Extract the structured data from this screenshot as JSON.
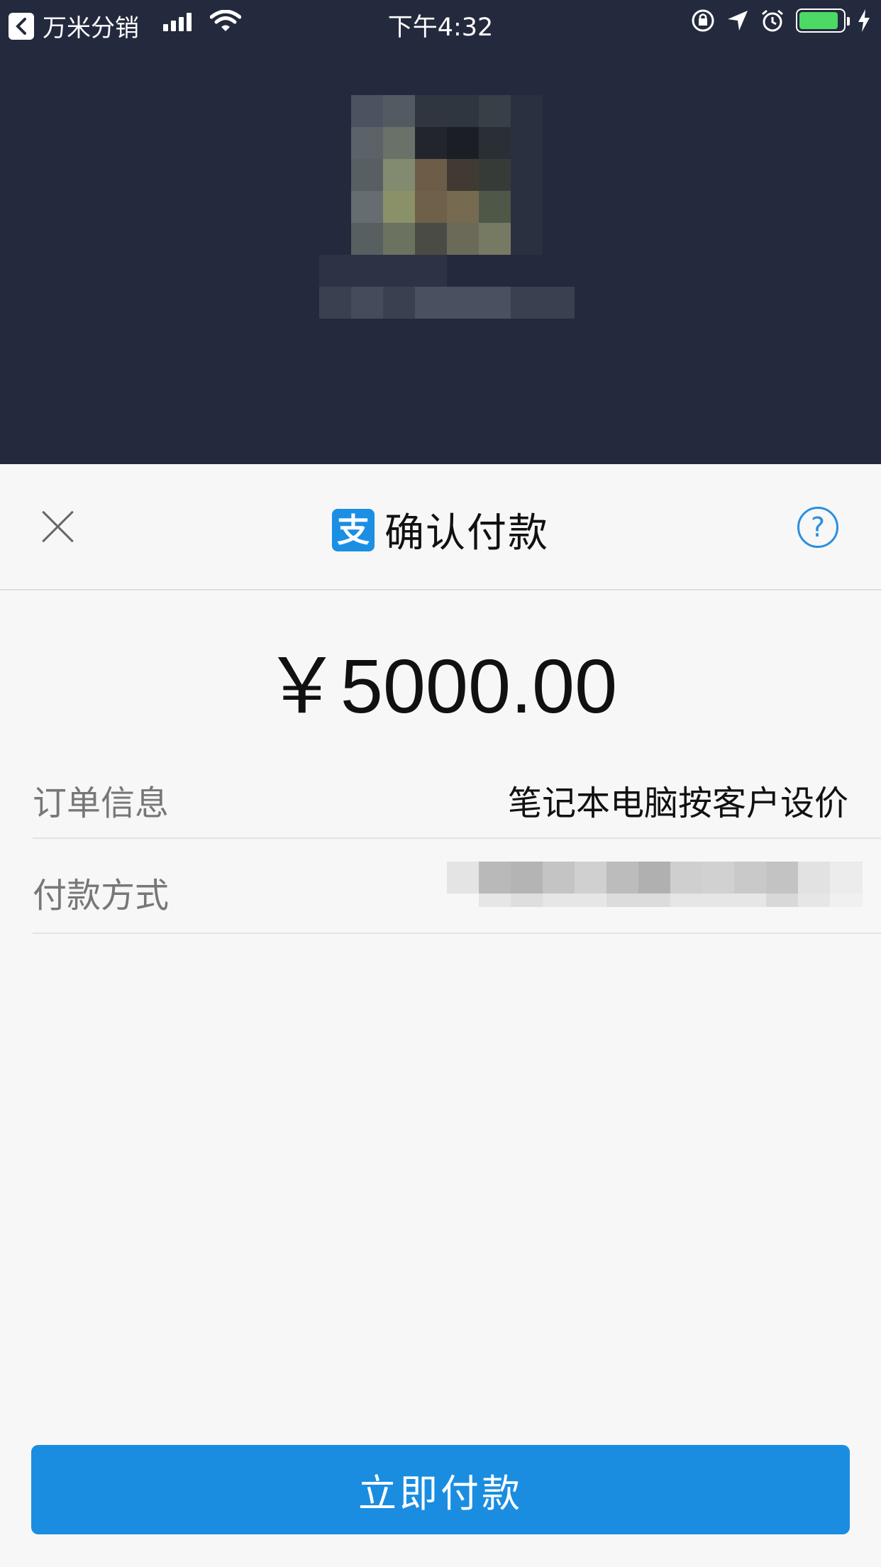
{
  "status_bar": {
    "back_app": "万米分销",
    "time": "下午4:32",
    "battery_level": 0.9
  },
  "sheet": {
    "title": "确认付款",
    "logo_glyph": "支",
    "help_glyph": "?",
    "amount": "￥5000.00",
    "order_label": "订单信息",
    "order_value": "笔记本电脑按客户设价",
    "payment_label": "付款方式",
    "pay_button": "立即付款"
  },
  "colors": {
    "header_bg": "#242a3d",
    "accent": "#1a8de1",
    "sheet_bg": "#f7f7f7"
  }
}
